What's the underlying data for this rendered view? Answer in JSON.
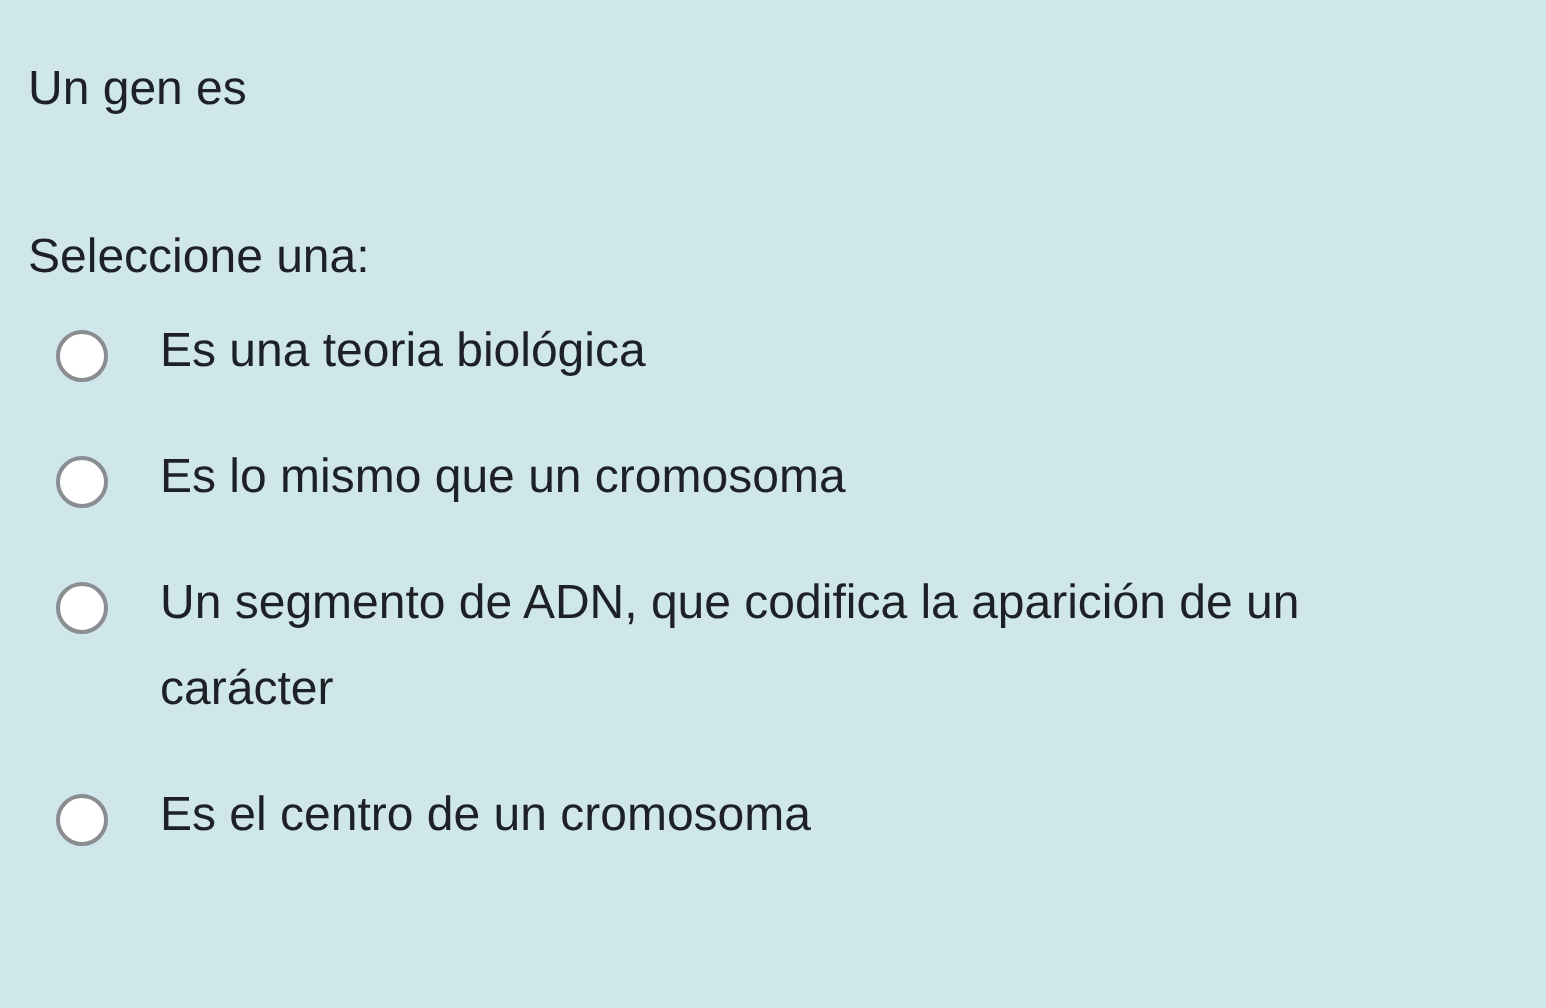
{
  "question": {
    "text": "Un gen es",
    "prompt": "Seleccione una:"
  },
  "options": [
    {
      "label": "Es una teoria biológica",
      "selected": false
    },
    {
      "label": "Es lo mismo que un cromosoma",
      "selected": false
    },
    {
      "label": "Un segmento de ADN, que codifica la aparición de un carácter",
      "selected": false
    },
    {
      "label": "Es el centro de un cromosoma",
      "selected": false
    }
  ]
}
